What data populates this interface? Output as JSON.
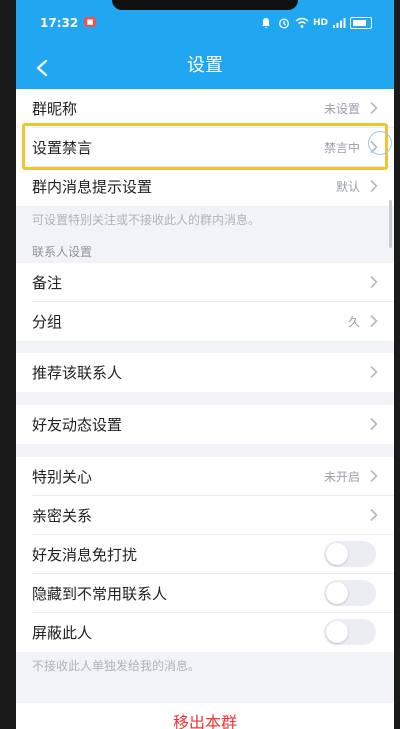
{
  "status_bar": {
    "time": "17:32",
    "network": "HD"
  },
  "header": {
    "title": "设置"
  },
  "group1": {
    "nickname": {
      "label": "群昵称",
      "value": "未设置"
    },
    "mute": {
      "label": "设置禁言",
      "value": "禁言中"
    },
    "msg_setting": {
      "label": "群内消息提示设置",
      "value": "默认"
    },
    "hint": "可设置特别关注或不接收此人的群内消息。"
  },
  "contact_section": {
    "header": "联系人设置",
    "remark": {
      "label": "备注"
    },
    "group": {
      "label": "分组",
      "value": "久"
    }
  },
  "recommend": {
    "label": "推荐该联系人"
  },
  "friend_feed": {
    "label": "好友动态设置"
  },
  "group3": {
    "special_care": {
      "label": "特别关心",
      "value": "未开启"
    },
    "intimacy": {
      "label": "亲密关系"
    },
    "dnd": {
      "label": "好友消息免打扰",
      "checked": false
    },
    "hide": {
      "label": "隐藏到不常用联系人",
      "checked": false
    },
    "block": {
      "label": "屏蔽此人",
      "checked": false
    },
    "hint": "不接收此人单独发给我的消息。"
  },
  "bottom_button": {
    "label": "移出本群"
  },
  "colors": {
    "header_bg": "#21a7f1",
    "highlight_border": "#f2c230",
    "danger": "#f2353a",
    "page_bg": "#f2f3f7"
  }
}
